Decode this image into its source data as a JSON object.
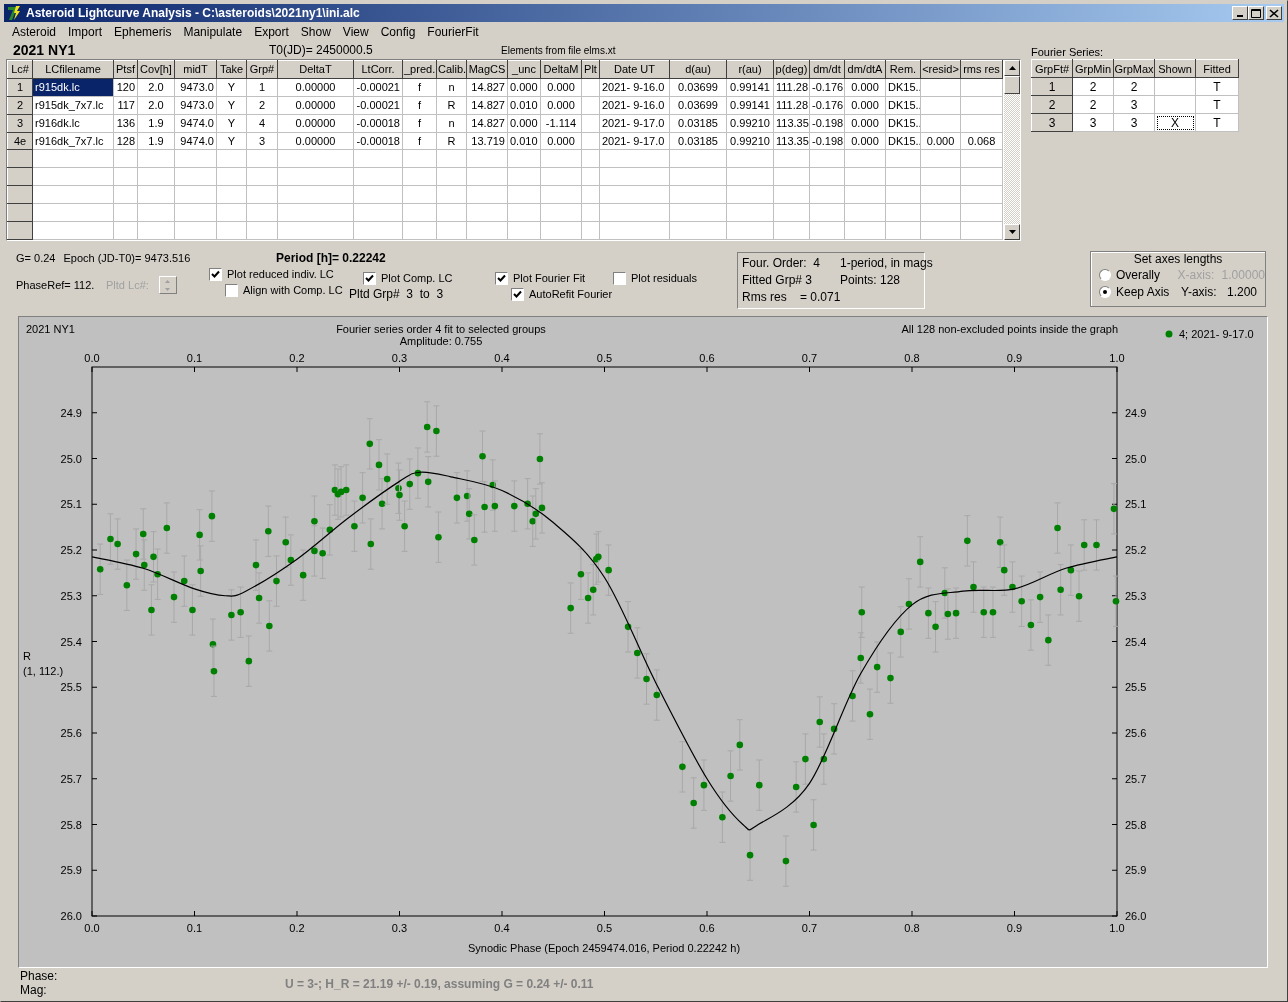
{
  "window": {
    "title": "Asteroid Lightcurve Analysis - C:\\asteroids\\2021ny1\\ini.alc"
  },
  "menu": [
    "Asteroid",
    "Import",
    "Ephemeris",
    "Manipulate",
    "Export",
    "Show",
    "View",
    "Config",
    "FourierFit"
  ],
  "header": {
    "asteroid": "2021 NY1",
    "t0": "T0(JD)= 2450000.5",
    "elements": "Elements from file elms.xt"
  },
  "table": {
    "columns": [
      "Lc#",
      "LCfilename",
      "Ptsf",
      "Cov[h]",
      "midT",
      "Take",
      "Grp#",
      "DeltaT",
      "LtCorr.",
      "_pred.",
      "Calib.",
      "MagCS",
      "_unc",
      "DeltaM",
      "Plt",
      "Date UT",
      "d(au)",
      "r(au)",
      "p(deg)",
      "dm/dt",
      "dm/dtA",
      "Rem.",
      "<resid>",
      "rms res"
    ],
    "rows": [
      {
        "selected": true,
        "cells": [
          "1",
          "r915dk.lc",
          "120",
          "2.0",
          "9473.0",
          "Y",
          "1",
          "0.00000",
          "-0.00021",
          "f",
          "n",
          "14.827",
          "0.000",
          "0.000",
          null,
          "2021- 9-16.0",
          "0.03699",
          "0.99141",
          "111.28",
          "-0.176",
          "0.000",
          "DK15..",
          null,
          null
        ]
      },
      {
        "selected": false,
        "cells": [
          "2",
          "r915dk_7x7.lc",
          "117",
          "2.0",
          "9473.0",
          "Y",
          "2",
          "0.00000",
          "-0.00021",
          "f",
          "R",
          "14.827",
          "0.010",
          "0.000",
          null,
          "2021- 9-16.0",
          "0.03699",
          "0.99141",
          "111.28",
          "-0.176",
          "0.000",
          "DK15..",
          null,
          null
        ]
      },
      {
        "selected": false,
        "cells": [
          "3",
          "r916dk.lc",
          "136",
          "1.9",
          "9474.0",
          "Y",
          "4",
          "0.00000",
          "-0.00018",
          "f",
          "n",
          "14.827",
          "0.000",
          "-1.114",
          null,
          "2021- 9-17.0",
          "0.03185",
          "0.99210",
          "113.35",
          "-0.198",
          "0.000",
          "DK15..",
          null,
          null
        ]
      },
      {
        "selected": false,
        "cells": [
          "4e",
          "r916dk_7x7.lc",
          "128",
          "1.9",
          "9474.0",
          "Y",
          "3",
          "0.00000",
          "-0.00018",
          "f",
          "R",
          "13.719",
          "0.010",
          "0.000",
          null,
          "2021- 9-17.0",
          "0.03185",
          "0.99210",
          "113.35",
          "-0.198",
          "0.000",
          "DK15..",
          "0.000",
          "0.068"
        ]
      }
    ]
  },
  "fourier_series": {
    "label": "Fourier Series:",
    "columns": [
      "GrpFt#",
      "GrpMin",
      "GrpMax",
      "Shown",
      "Fitted"
    ],
    "rows": [
      {
        "grp": "1",
        "min": "2",
        "max": "2",
        "fitted": "T",
        "focused": false
      },
      {
        "grp": "2",
        "min": "2",
        "max": "3",
        "fitted": "T",
        "focused": false
      },
      {
        "grp": "3",
        "min": "3",
        "max": "3",
        "shown": "X",
        "fitted": "T",
        "focused": true
      }
    ]
  },
  "parameters": {
    "g": "G= 0.24",
    "epoch": "Epoch (JD-T0)= 9473.516",
    "period": "Period [h]= 0.22242",
    "phase_ref": "PhaseRef= 112.",
    "pltd_lc": {
      "label": "Pltd Lc#:",
      "disabled": true
    },
    "pltd_grp": "Pltd Grp#  3  to  3"
  },
  "checkboxes": [
    {
      "label": "Plot reduced indiv. LC",
      "checked": true
    },
    {
      "label": "Align with Comp. LC",
      "checked": false
    },
    {
      "label": "Plot Comp. LC",
      "checked": true
    },
    {
      "label": "Plot Fourier Fit",
      "checked": true
    },
    {
      "label": "AutoRefit Fourier",
      "checked": true
    },
    {
      "label": "Plot residuals",
      "checked": false
    }
  ],
  "fit_info": [
    "Four. Order:  4",
    "1-period, in mags",
    "Fitted Grp# 3",
    "Points: 128",
    "Rms res    = 0.071"
  ],
  "axes_lengths": {
    "title": "Set axes lengths",
    "options": [
      {
        "label": "Overally",
        "selected": false
      },
      {
        "label": "Keep Axis",
        "selected": true
      }
    ],
    "x_axis": {
      "label": "X-axis:",
      "value": "1.00000",
      "disabled": true
    },
    "y_axis": {
      "label": "Y-axis:",
      "value": "1.200",
      "disabled": false
    }
  },
  "plot": {
    "chart_data": {
      "type": "scatter",
      "title": "Fourier series order 4 fit to selected groups",
      "xlabel": "Synodic Phase (Epoch 2459474.016, Period 0.22242 h)",
      "ylabel": "R",
      "xlim": [
        0,
        1
      ],
      "ylim": [
        26.0,
        24.8
      ],
      "xticks": [
        {
          "value": 0,
          "label": "0.0"
        },
        {
          "value": 0.1,
          "label": "0.1"
        },
        {
          "value": 0.2,
          "label": "0.2"
        },
        {
          "value": 0.3,
          "label": "0.3"
        },
        {
          "value": 0.4,
          "label": "0.4"
        },
        {
          "value": 0.5,
          "label": "0.5"
        },
        {
          "value": 0.6,
          "label": "0.6"
        },
        {
          "value": 0.7,
          "label": "0.7"
        },
        {
          "value": 0.8,
          "label": "0.8"
        },
        {
          "value": 0.9,
          "label": "0.9"
        },
        {
          "value": 1,
          "label": "1.0"
        }
      ],
      "yticks": [
        {
          "value": 24.9,
          "label": "24.9"
        },
        {
          "value": 25,
          "label": "25.0"
        },
        {
          "value": 25.1,
          "label": "25.1"
        },
        {
          "value": 25.2,
          "label": "25.2"
        },
        {
          "value": 25.3,
          "label": "25.3"
        },
        {
          "value": 25.4,
          "label": "25.4"
        },
        {
          "value": 25.5,
          "label": "25.5"
        },
        {
          "value": 25.6,
          "label": "25.6"
        },
        {
          "value": 25.7,
          "label": "25.7"
        },
        {
          "value": 25.8,
          "label": "25.8"
        },
        {
          "value": 25.9,
          "label": "25.9"
        },
        {
          "value": 26,
          "label": "26.0"
        }
      ],
      "annotations": [
        {
          "text": "2021 NY1"
        },
        {
          "text": "Amplitude: 0.755"
        },
        {
          "text": "All 128 non-excluded points inside the graph"
        },
        {
          "text": "(1, 112.)"
        }
      ],
      "series": [
        {
          "name": "4; 2021- 9-17.0",
          "type": "scatter",
          "color": "#008000",
          "errors": [
            0.055,
            0.055,
            0.055,
            0.055,
            0.055,
            0.055,
            0.055,
            0.055,
            0.055,
            0.055,
            0.055,
            0.055,
            0.055,
            0.055,
            0.055,
            0.055,
            0.055,
            0.055,
            0.055,
            0.055,
            0.055,
            0.055,
            0.055,
            0.055,
            0.055,
            0.055,
            0.055,
            0.055,
            0.055,
            0.055,
            0.055,
            0.055,
            0.055,
            0.055,
            0.055,
            0.055,
            0.055,
            0.055,
            0.055,
            0.055,
            0.055,
            0.055,
            0.055,
            0.055,
            0.055,
            0.055,
            0.055,
            0.055,
            0.055,
            0.055,
            0.055,
            0.055,
            0.055,
            0.055,
            0.055,
            0.055,
            0.055,
            0.055,
            0.055,
            0.055,
            0.055,
            0.055,
            0.055,
            0.055,
            0.055,
            0.055,
            0.055,
            0.055,
            0.055,
            0.055,
            0.055,
            0.055,
            0.055,
            0.055,
            0.055,
            0.055,
            0.055,
            0.055,
            0.055,
            0.055,
            0.055,
            0.055,
            0.055,
            0.055,
            0.055,
            0.055,
            0.055,
            0.055,
            0.055,
            0.055,
            0.055,
            0.055,
            0.055,
            0.055,
            0.055,
            0.055,
            0.055,
            0.055,
            0.055,
            0.055,
            0.055,
            0.055,
            0.055,
            0.055,
            0.055,
            0.055,
            0.055,
            0.055,
            0.055,
            0.055,
            0.055,
            0.055,
            0.055,
            0.055,
            0.055,
            0.055,
            0.055,
            0.055,
            0.055,
            0.055,
            0.055,
            0.055,
            0.055,
            0.055,
            0.055,
            0.055,
            0.055
          ],
          "x": [
            0.008,
            0.018,
            0.025,
            0.034,
            0.043,
            0.05,
            0.051,
            0.058,
            0.06,
            0.064,
            0.073,
            0.08,
            0.09,
            0.098,
            0.105,
            0.106,
            0.117,
            0.118,
            0.119,
            0.136,
            0.145,
            0.153,
            0.16,
            0.163,
            0.172,
            0.173,
            0.18,
            0.189,
            0.194,
            0.206,
            0.217,
            0.217,
            0.225,
            0.232,
            0.237,
            0.24,
            0.243,
            0.248,
            0.256,
            0.264,
            0.271,
            0.272,
            0.28,
            0.283,
            0.288,
            0.299,
            0.3,
            0.305,
            0.31,
            0.318,
            0.327,
            0.328,
            0.336,
            0.338,
            0.356,
            0.366,
            0.368,
            0.373,
            0.381,
            0.383,
            0.391,
            0.393,
            0.412,
            0.425,
            0.43,
            0.433,
            0.437,
            0.439,
            0.467,
            0.477,
            0.484,
            0.489,
            0.492,
            0.494,
            0.504,
            0.523,
            0.532,
            0.541,
            0.551,
            0.576,
            0.587,
            0.597,
            0.615,
            0.623,
            0.632,
            0.642,
            0.651,
            0.677,
            0.687,
            0.696,
            0.704,
            0.71,
            0.714,
            0.724,
            0.742,
            0.75,
            0.751,
            0.759,
            0.766,
            0.779,
            0.789,
            0.797,
            0.808,
            0.816,
            0.823,
            0.832,
            0.835,
            0.843,
            0.854,
            0.86,
            0.87,
            0.879,
            0.886,
            0.89,
            0.898,
            0.907,
            0.916,
            0.925,
            0.933,
            0.942,
            0.945,
            0.955,
            0.963,
            0.968,
            0.98,
            0.997,
            0.999
          ],
          "values": [
            25.242,
            25.176,
            25.187,
            25.277,
            25.209,
            25.165,
            25.233,
            25.331,
            25.215,
            25.253,
            25.152,
            25.303,
            25.268,
            25.331,
            25.167,
            25.246,
            25.126,
            25.406,
            25.465,
            25.342,
            25.336,
            25.443,
            25.233,
            25.305,
            25.159,
            25.366,
            25.268,
            25.183,
            25.222,
            25.255,
            25.137,
            25.202,
            25.207,
            25.156,
            25.069,
            25.078,
            25.073,
            25.069,
            25.148,
            25.086,
            24.968,
            25.187,
            25.014,
            25.099,
            25.045,
            25.065,
            25.08,
            25.148,
            25.056,
            25.032,
            24.931,
            25.051,
            24.94,
            25.172,
            25.086,
            25.082,
            25.121,
            25.178,
            24.995,
            25.106,
            25.058,
            25.104,
            25.104,
            25.099,
            25.137,
            25.121,
            25.001,
            25.108,
            25.327,
            25.253,
            25.305,
            25.287,
            25.22,
            25.215,
            25.244,
            25.368,
            25.425,
            25.482,
            25.517,
            25.674,
            25.753,
            25.714,
            25.784,
            25.694,
            25.626,
            25.867,
            25.714,
            25.88,
            25.718,
            25.657,
            25.801,
            25.576,
            25.657,
            25.591,
            25.519,
            25.436,
            25.336,
            25.559,
            25.456,
            25.48,
            25.379,
            25.318,
            25.226,
            25.338,
            25.368,
            25.294,
            25.34,
            25.338,
            25.18,
            25.281,
            25.336,
            25.336,
            25.183,
            25.244,
            25.281,
            25.312,
            25.364,
            25.303,
            25.397,
            25.152,
            25.287,
            25.244,
            25.301,
            25.189,
            25.189,
            25.11,
            25.312
          ]
        },
        {
          "type": "line",
          "color": "#000000",
          "x": [
            0,
            0.05,
            0.1,
            0.13,
            0.15,
            0.2,
            0.25,
            0.3,
            0.32,
            0.35,
            0.4,
            0.45,
            0.5,
            0.55,
            0.6,
            0.635,
            0.65,
            0.7,
            0.75,
            0.8,
            0.85,
            0.9,
            0.95,
            1
          ],
          "values": [
            25.215,
            25.24,
            25.285,
            25.3,
            25.29,
            25.22,
            25.13,
            25.05,
            25.03,
            25.04,
            25.07,
            25.14,
            25.26,
            25.49,
            25.7,
            25.8,
            25.8,
            25.71,
            25.47,
            25.32,
            25.29,
            25.285,
            25.24,
            25.215
          ]
        }
      ]
    }
  },
  "status": {
    "phase": "Phase:",
    "mag": "Mag:",
    "result": "U = 3-; H_R = 21.19 +/- 0.19, assuming G = 0.24 +/- 0.11"
  }
}
